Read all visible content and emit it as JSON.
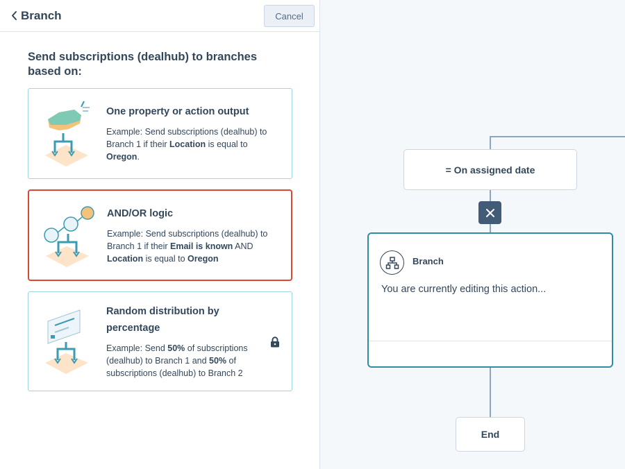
{
  "panel": {
    "back_label": "Branch",
    "cancel_label": "Cancel",
    "intro": "Send subscriptions (dealhub) to branches based on:"
  },
  "options": [
    {
      "title": "One property or action output",
      "desc_parts": [
        "Example: Send subscriptions (dealhub) to Branch 1 if their ",
        "Location",
        " is equal to ",
        "Oregon",
        "."
      ],
      "selected": false,
      "icon": "map-branch-illustration"
    },
    {
      "title": "AND/OR logic",
      "desc_parts": [
        "Example: Send subscriptions (dealhub) to Branch 1 if their ",
        "Email is known",
        " AND ",
        "Location",
        " is equal to ",
        "Oregon"
      ],
      "selected": true,
      "icon": "and-or-logic-illustration"
    },
    {
      "title": "Random distribution by percentage",
      "desc_parts": [
        "Example: Send ",
        "50%",
        " of subscriptions (dealhub) to Branch 1 and ",
        "50%",
        " of subscriptions (dealhub) to Branch 2"
      ],
      "selected": false,
      "locked": true,
      "icon": "percentage-distribution-illustration"
    }
  ],
  "flow": {
    "assigned_node": "= On assigned date",
    "branch_title": "Branch",
    "branch_message": "You are currently editing this action...",
    "end_node": "End"
  },
  "colors": {
    "accent_teal": "#2e8da3",
    "selected_red": "#d9482f",
    "text": "#33475b",
    "dark_button": "#425b76"
  }
}
